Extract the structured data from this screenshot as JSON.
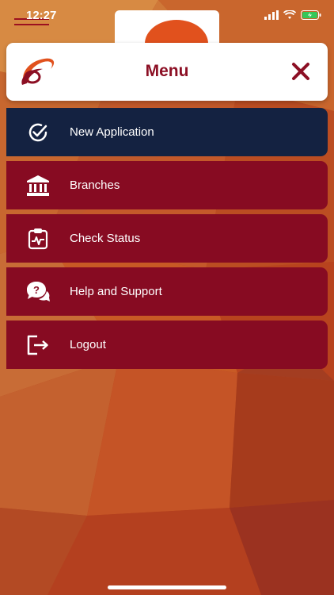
{
  "status_bar": {
    "time": "12:27"
  },
  "header": {
    "title": "Menu",
    "logo_icon": "brand-swoosh-logo",
    "close_icon": "close-x-icon"
  },
  "menu": {
    "items": [
      {
        "label": "New Application",
        "icon": "check-circle-icon",
        "active": true
      },
      {
        "label": "Branches",
        "icon": "bank-building-icon",
        "active": false
      },
      {
        "label": "Check Status",
        "icon": "clipboard-pulse-icon",
        "active": false
      },
      {
        "label": "Help and Support",
        "icon": "chat-question-icon",
        "active": false
      },
      {
        "label": "Logout",
        "icon": "logout-icon",
        "active": false
      }
    ]
  },
  "colors": {
    "brand_red": "#870b22",
    "active_navy": "#142241",
    "title_red": "#8c0f24",
    "accent_orange": "#e1511d"
  }
}
